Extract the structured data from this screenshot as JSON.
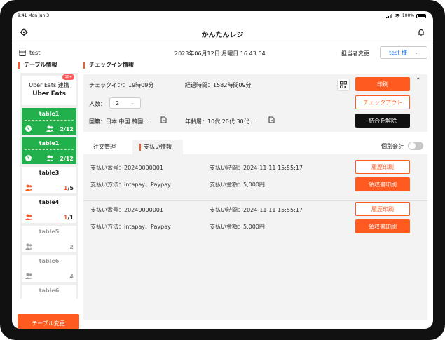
{
  "status_bar": {
    "time": "9:41 Mon Jun 3",
    "battery": "100%"
  },
  "header": {
    "title": "かんたんレジ"
  },
  "info": {
    "store_name": "test",
    "datetime": "2023年06月12日 月曜日 16:43:54",
    "staff_label": "担当者変更",
    "staff_value": "test 様"
  },
  "sidebar": {
    "title": "テーブル情報",
    "uber": {
      "line1": "Uber Eats 連携",
      "line2": "Uber Eats",
      "badge": "10+"
    },
    "tables": [
      {
        "name": "table1",
        "occupied": "2",
        "capacity": "12",
        "state": "occupied"
      },
      {
        "name": "table1",
        "occupied": "2",
        "capacity": "12",
        "state": "occupied"
      },
      {
        "name": "table3",
        "occupied": "1",
        "capacity": "5",
        "state": "partial"
      },
      {
        "name": "table4",
        "occupied": "1",
        "capacity": "1",
        "state": "partial"
      },
      {
        "name": "table5",
        "count": "2",
        "state": "empty"
      },
      {
        "name": "table6",
        "count": "4",
        "state": "empty"
      },
      {
        "name": "table6",
        "count": "",
        "state": "empty"
      }
    ],
    "change_button": "テーブル変更"
  },
  "checkin": {
    "title": "チェックイン情報",
    "checkin_time": "チェックイン：19時09分",
    "elapsed": "経過時間：1582時間09分",
    "people_label": "人数：",
    "people_value": "2",
    "nationality": "国籍：日本 中国 韓国...",
    "age": "年齢層：10代 20代 30代 ...",
    "print_button": "印刷",
    "checkout_button": "チェックアウト",
    "unmerge_button": "結合を解除"
  },
  "tabs": {
    "order": "注文管理",
    "payment": "支払い情報",
    "individual": "個別会計"
  },
  "payments": [
    {
      "number": "支払い番号：20240000001",
      "time": "支払い時間：2024-11-11 15:55:17",
      "method": "支払い方法：intapay、Paypay",
      "amount": "支払い金額：5,000円",
      "history_button": "履歴印刷",
      "receipt_button": "領収書印刷"
    },
    {
      "number": "支払い番号：20240000001",
      "time": "支払い時間：2024-11-11 15:55:17",
      "method": "支払い方法：intapay、Paypay",
      "amount": "支払い金額：5,000円",
      "history_button": "履歴印刷",
      "receipt_button": "領収書印刷"
    }
  ],
  "colors": {
    "accent": "#ff5a1f",
    "green": "#21b04b",
    "black": "#111111"
  }
}
